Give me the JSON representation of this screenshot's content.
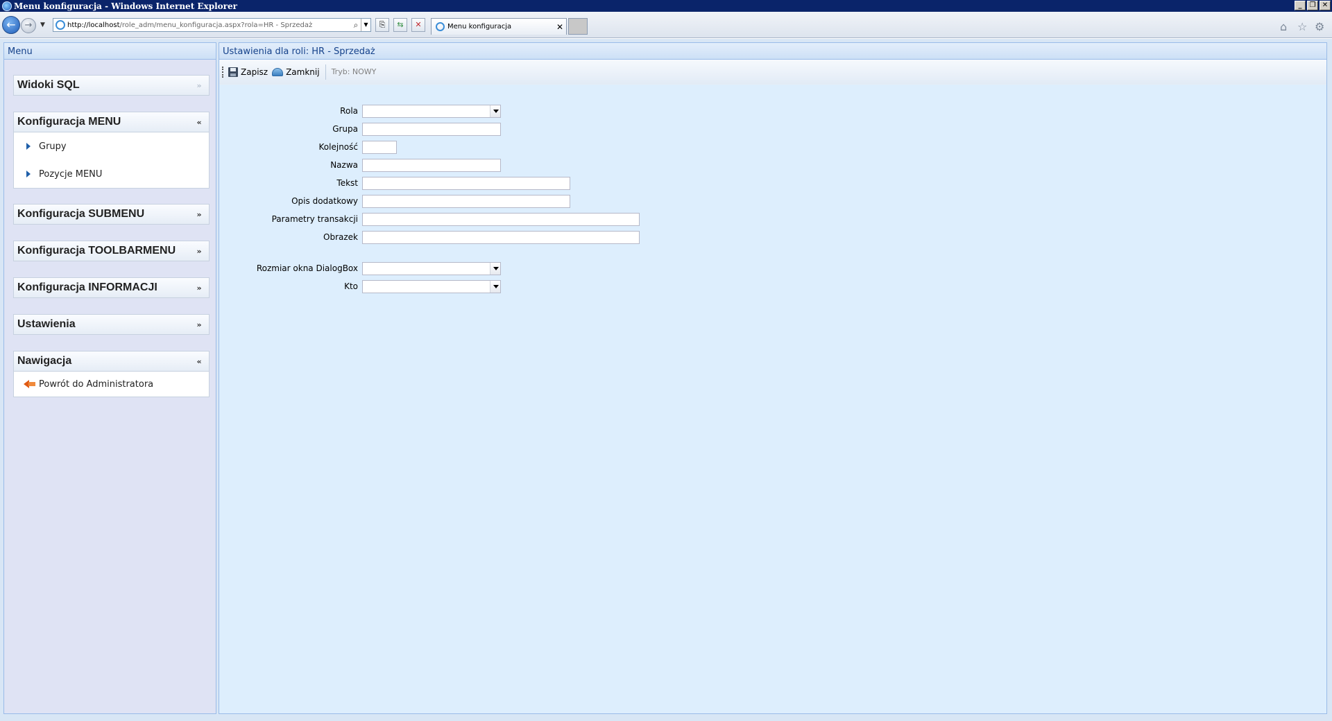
{
  "window": {
    "title": "Menu konfiguracja - Windows Internet Explorer"
  },
  "browser": {
    "url_host": "http://localhost",
    "url_path": "/role_adm/menu_konfiguracja.aspx?rola=HR - Sprzedaż",
    "tab_label": "Menu konfiguracja"
  },
  "left_panel": {
    "title": "Menu",
    "sections": [
      {
        "title": "Widoki SQL",
        "expanded": false,
        "items": []
      },
      {
        "title": "Konfiguracja MENU",
        "expanded": true,
        "items": [
          "Grupy",
          "Pozycje MENU"
        ]
      },
      {
        "title": "Konfiguracja SUBMENU",
        "expanded": false,
        "items": []
      },
      {
        "title": "Konfiguracja TOOLBARMENU",
        "expanded": false,
        "items": []
      },
      {
        "title": "Konfiguracja INFORMACJI",
        "expanded": false,
        "items": []
      },
      {
        "title": "Ustawienia",
        "expanded": false,
        "items": []
      },
      {
        "title": "Nawigacja",
        "expanded": true,
        "items": [
          "Powrót do Administratora"
        ]
      }
    ]
  },
  "main": {
    "title": "Ustawienia dla roli: HR - Sprzedaż",
    "toolbar": {
      "save_label": "Zapisz",
      "close_label": "Zamknij",
      "mode_label": "Tryb: NOWY"
    },
    "form": {
      "rola": {
        "label": "Rola",
        "value": ""
      },
      "grupa": {
        "label": "Grupa",
        "value": ""
      },
      "kolejnosc": {
        "label": "Kolejność",
        "value": ""
      },
      "nazwa": {
        "label": "Nazwa",
        "value": ""
      },
      "tekst": {
        "label": "Tekst",
        "value": ""
      },
      "opis": {
        "label": "Opis dodatkowy",
        "value": ""
      },
      "parametry": {
        "label": "Parametry transakcji",
        "value": ""
      },
      "obrazek": {
        "label": "Obrazek",
        "value": ""
      },
      "rozmiar": {
        "label": "Rozmiar okna DialogBox",
        "value": ""
      },
      "kto": {
        "label": "Kto",
        "value": ""
      }
    }
  }
}
